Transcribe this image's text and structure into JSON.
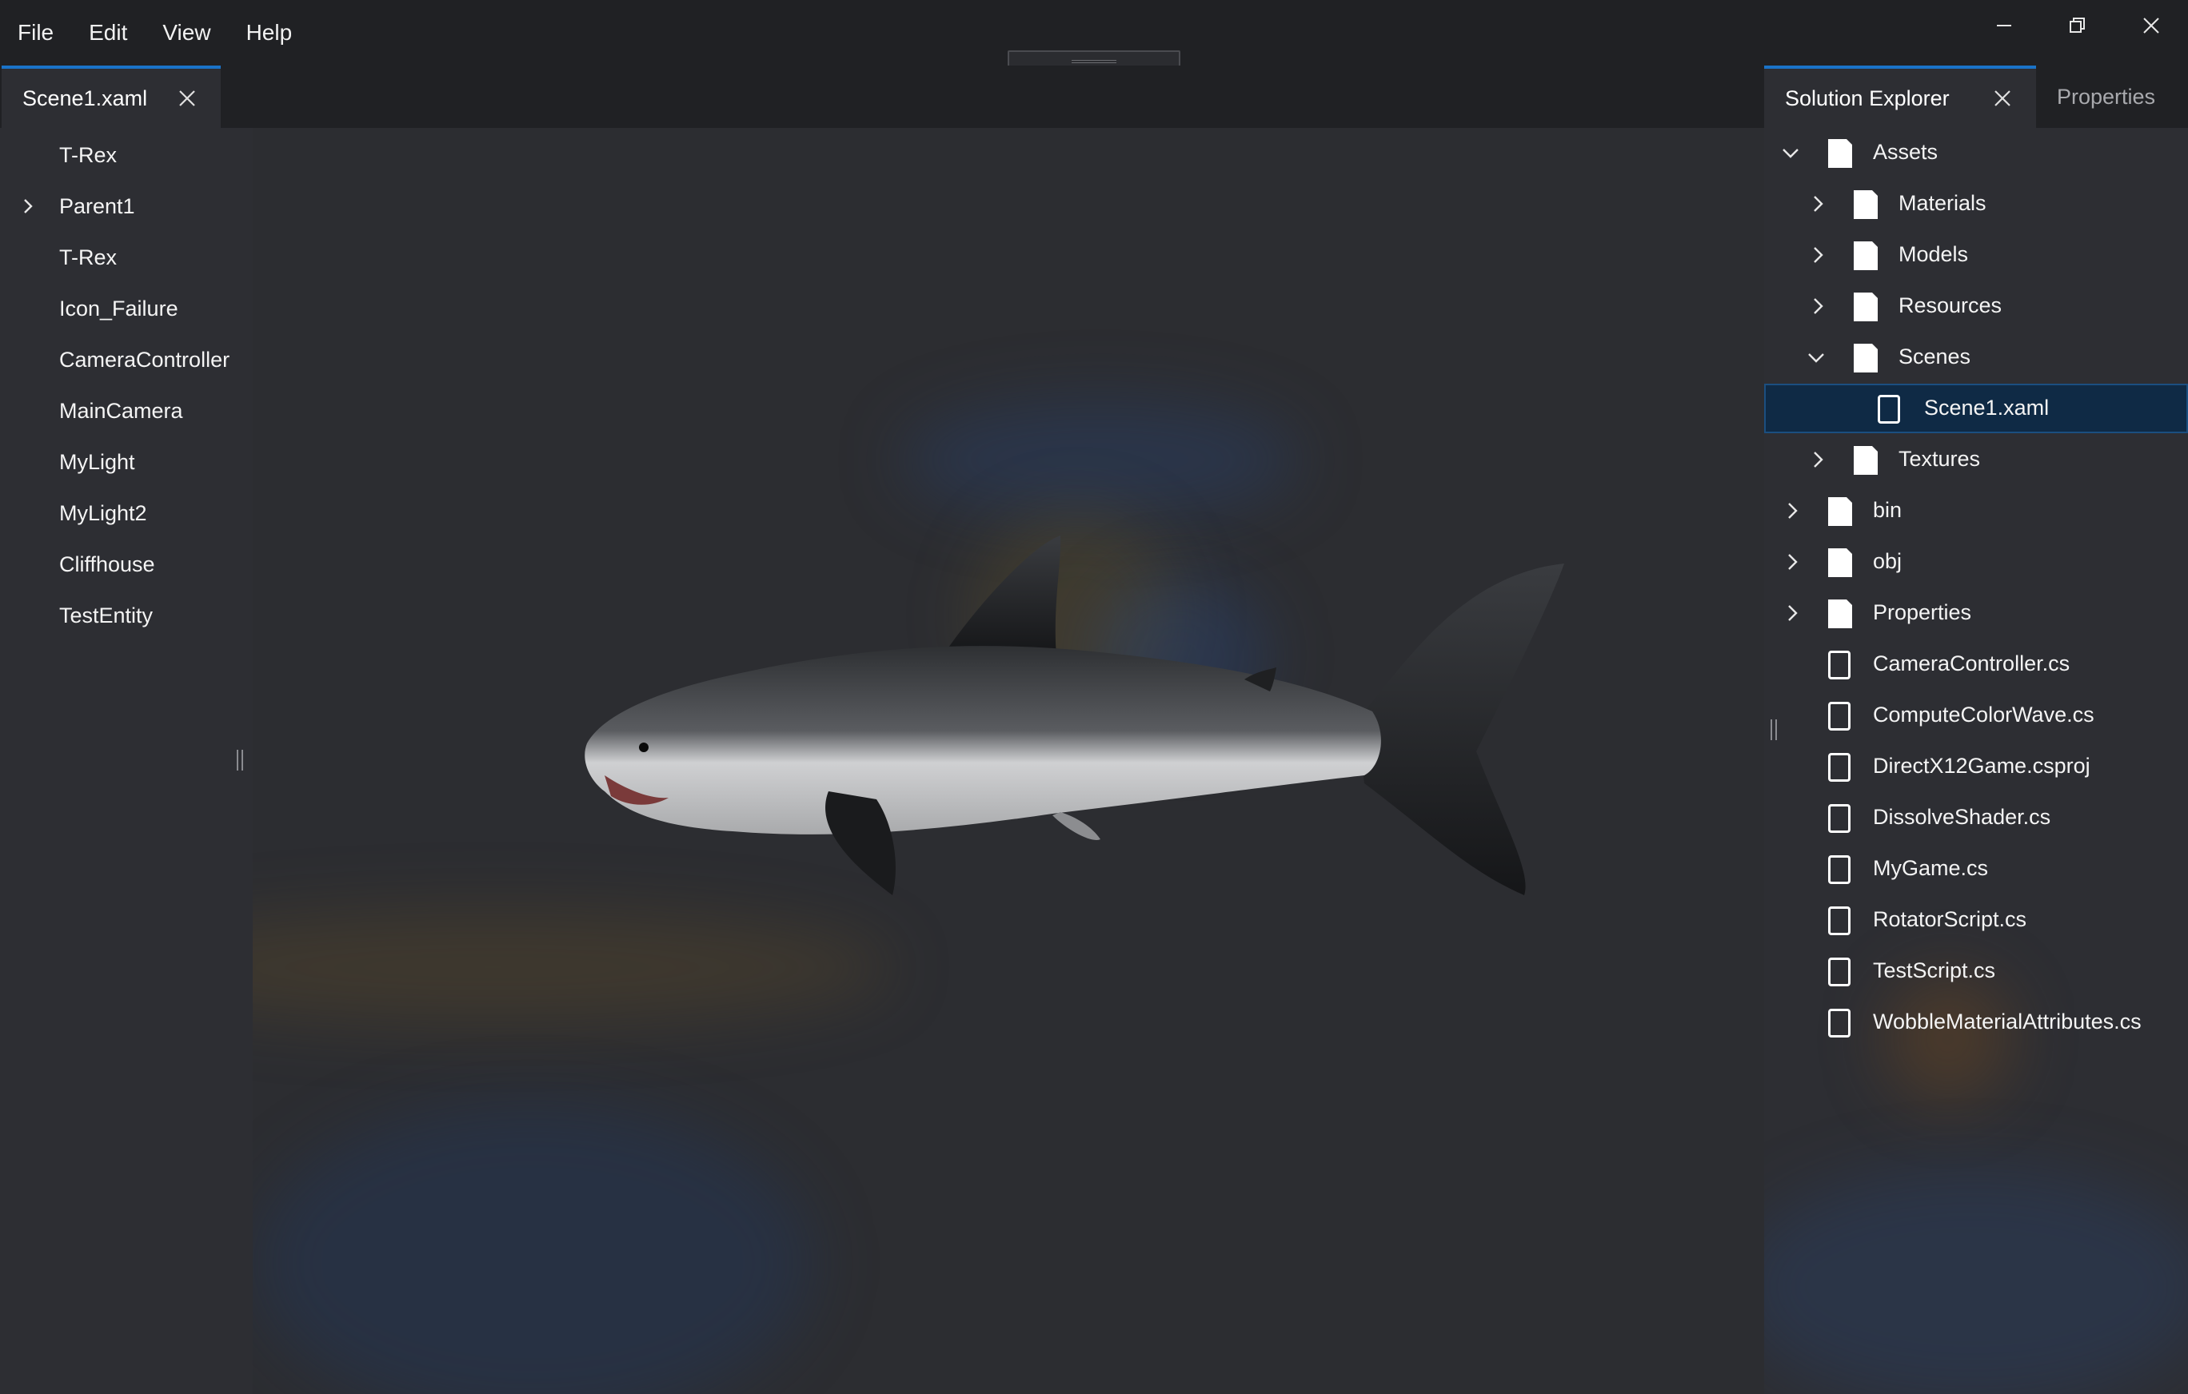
{
  "menu": [
    "File",
    "Edit",
    "View",
    "Help"
  ],
  "window_controls": {
    "minimize_icon": "minimize-icon",
    "restore_icon": "restore-icon",
    "close_icon": "close-icon"
  },
  "document_tab": {
    "label": "Scene1.xaml",
    "active": true
  },
  "hierarchy": {
    "items": [
      {
        "label": "T-Rex",
        "expandable": false
      },
      {
        "label": "Parent1",
        "expandable": true
      },
      {
        "label": "T-Rex",
        "expandable": false
      },
      {
        "label": "Icon_Failure",
        "expandable": false
      },
      {
        "label": "CameraController",
        "expandable": false
      },
      {
        "label": "MainCamera",
        "expandable": false
      },
      {
        "label": "MyLight",
        "expandable": false
      },
      {
        "label": "MyLight2",
        "expandable": false
      },
      {
        "label": "Cliffhouse",
        "expandable": false
      },
      {
        "label": "TestEntity",
        "expandable": false
      }
    ]
  },
  "viewport": {
    "subject": "great white shark model"
  },
  "side_tabs": {
    "active": "Solution Explorer",
    "inactive": "Properties"
  },
  "solution_explorer": {
    "items": [
      {
        "label": "Assets",
        "kind": "folder",
        "depth": 0,
        "state": "expanded"
      },
      {
        "label": "Materials",
        "kind": "folder",
        "depth": 1,
        "state": "collapsed"
      },
      {
        "label": "Models",
        "kind": "folder",
        "depth": 1,
        "state": "collapsed"
      },
      {
        "label": "Resources",
        "kind": "folder",
        "depth": 1,
        "state": "collapsed"
      },
      {
        "label": "Scenes",
        "kind": "folder",
        "depth": 1,
        "state": "expanded"
      },
      {
        "label": "Scene1.xaml",
        "kind": "file",
        "depth": 2,
        "selected": true
      },
      {
        "label": "Textures",
        "kind": "folder",
        "depth": 1,
        "state": "collapsed"
      },
      {
        "label": "bin",
        "kind": "folder",
        "depth": 0,
        "state": "collapsed"
      },
      {
        "label": "obj",
        "kind": "folder",
        "depth": 0,
        "state": "collapsed"
      },
      {
        "label": "Properties",
        "kind": "folder",
        "depth": 0,
        "state": "collapsed"
      },
      {
        "label": "CameraController.cs",
        "kind": "file",
        "depth": 0
      },
      {
        "label": "ComputeColorWave.cs",
        "kind": "file",
        "depth": 0
      },
      {
        "label": "DirectX12Game.csproj",
        "kind": "file",
        "depth": 0
      },
      {
        "label": "DissolveShader.cs",
        "kind": "file",
        "depth": 0
      },
      {
        "label": "MyGame.cs",
        "kind": "file",
        "depth": 0
      },
      {
        "label": "RotatorScript.cs",
        "kind": "file",
        "depth": 0
      },
      {
        "label": "TestScript.cs",
        "kind": "file",
        "depth": 0
      },
      {
        "label": "WobbleMaterialAttributes.cs",
        "kind": "file",
        "depth": 0
      }
    ]
  },
  "colors": {
    "accent": "#1a73c8",
    "panel": "#2d2e33",
    "chrome": "#202124",
    "selection": "#0f2a45"
  }
}
